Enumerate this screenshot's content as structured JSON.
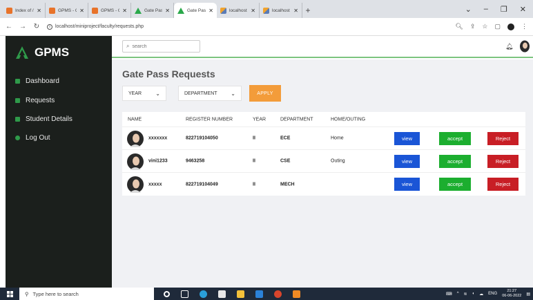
{
  "browser": {
    "tabs": [
      {
        "label": "Index of /",
        "favicon": "orange",
        "active": false
      },
      {
        "label": "GPMS - Gate Pa",
        "favicon": "orange",
        "active": false
      },
      {
        "label": "GPMS - Gate Pa",
        "favicon": "orange",
        "active": false
      },
      {
        "label": "Gate Pass Manag",
        "favicon": "green",
        "active": false
      },
      {
        "label": "Gate Pass Manag",
        "favicon": "green",
        "active": true
      },
      {
        "label": "localhost / 127.0",
        "favicon": "sql",
        "active": false
      },
      {
        "label": "localhost / 127.0",
        "favicon": "sql",
        "active": false
      }
    ],
    "url": "localhost/miniproject/faculty/requests.php"
  },
  "app": {
    "brand": "GPMS",
    "accent": "#2f9a4a"
  },
  "sidebar": {
    "items": [
      {
        "label": "Dashboard"
      },
      {
        "label": "Requests"
      },
      {
        "label": "Student Details"
      },
      {
        "label": "Log Out"
      }
    ]
  },
  "header": {
    "search_placeholder": "search"
  },
  "main": {
    "title": "Gate Pass Requests",
    "filters": {
      "year": "YEAR",
      "department": "DEPARTMENT",
      "apply_label": "APPLY"
    },
    "columns": [
      "NAME",
      "REGISTER NUMBER",
      "YEAR",
      "DEPARTMENT",
      "HOME/OUTING"
    ],
    "rows": [
      {
        "name": "xxxxxxx",
        "register": "822719104050",
        "year": "II",
        "department": "ECE",
        "type": "Home"
      },
      {
        "name": "vini1233",
        "register": "9463258",
        "year": "II",
        "department": "CSE",
        "type": "Outing"
      },
      {
        "name": "xxxxx",
        "register": "822719104049",
        "year": "II",
        "department": "MECH",
        "type": ""
      }
    ],
    "actions": {
      "view": "view",
      "accept": "accept",
      "reject": "Reject"
    },
    "colors": {
      "view": "#1a55d6",
      "accept": "#1cae2f",
      "reject": "#c81e25",
      "apply": "#f39c3a"
    }
  },
  "taskbar": {
    "search_placeholder": "Type here to search",
    "language": "ENG",
    "time": "21:27",
    "date": "06-06-2022"
  }
}
